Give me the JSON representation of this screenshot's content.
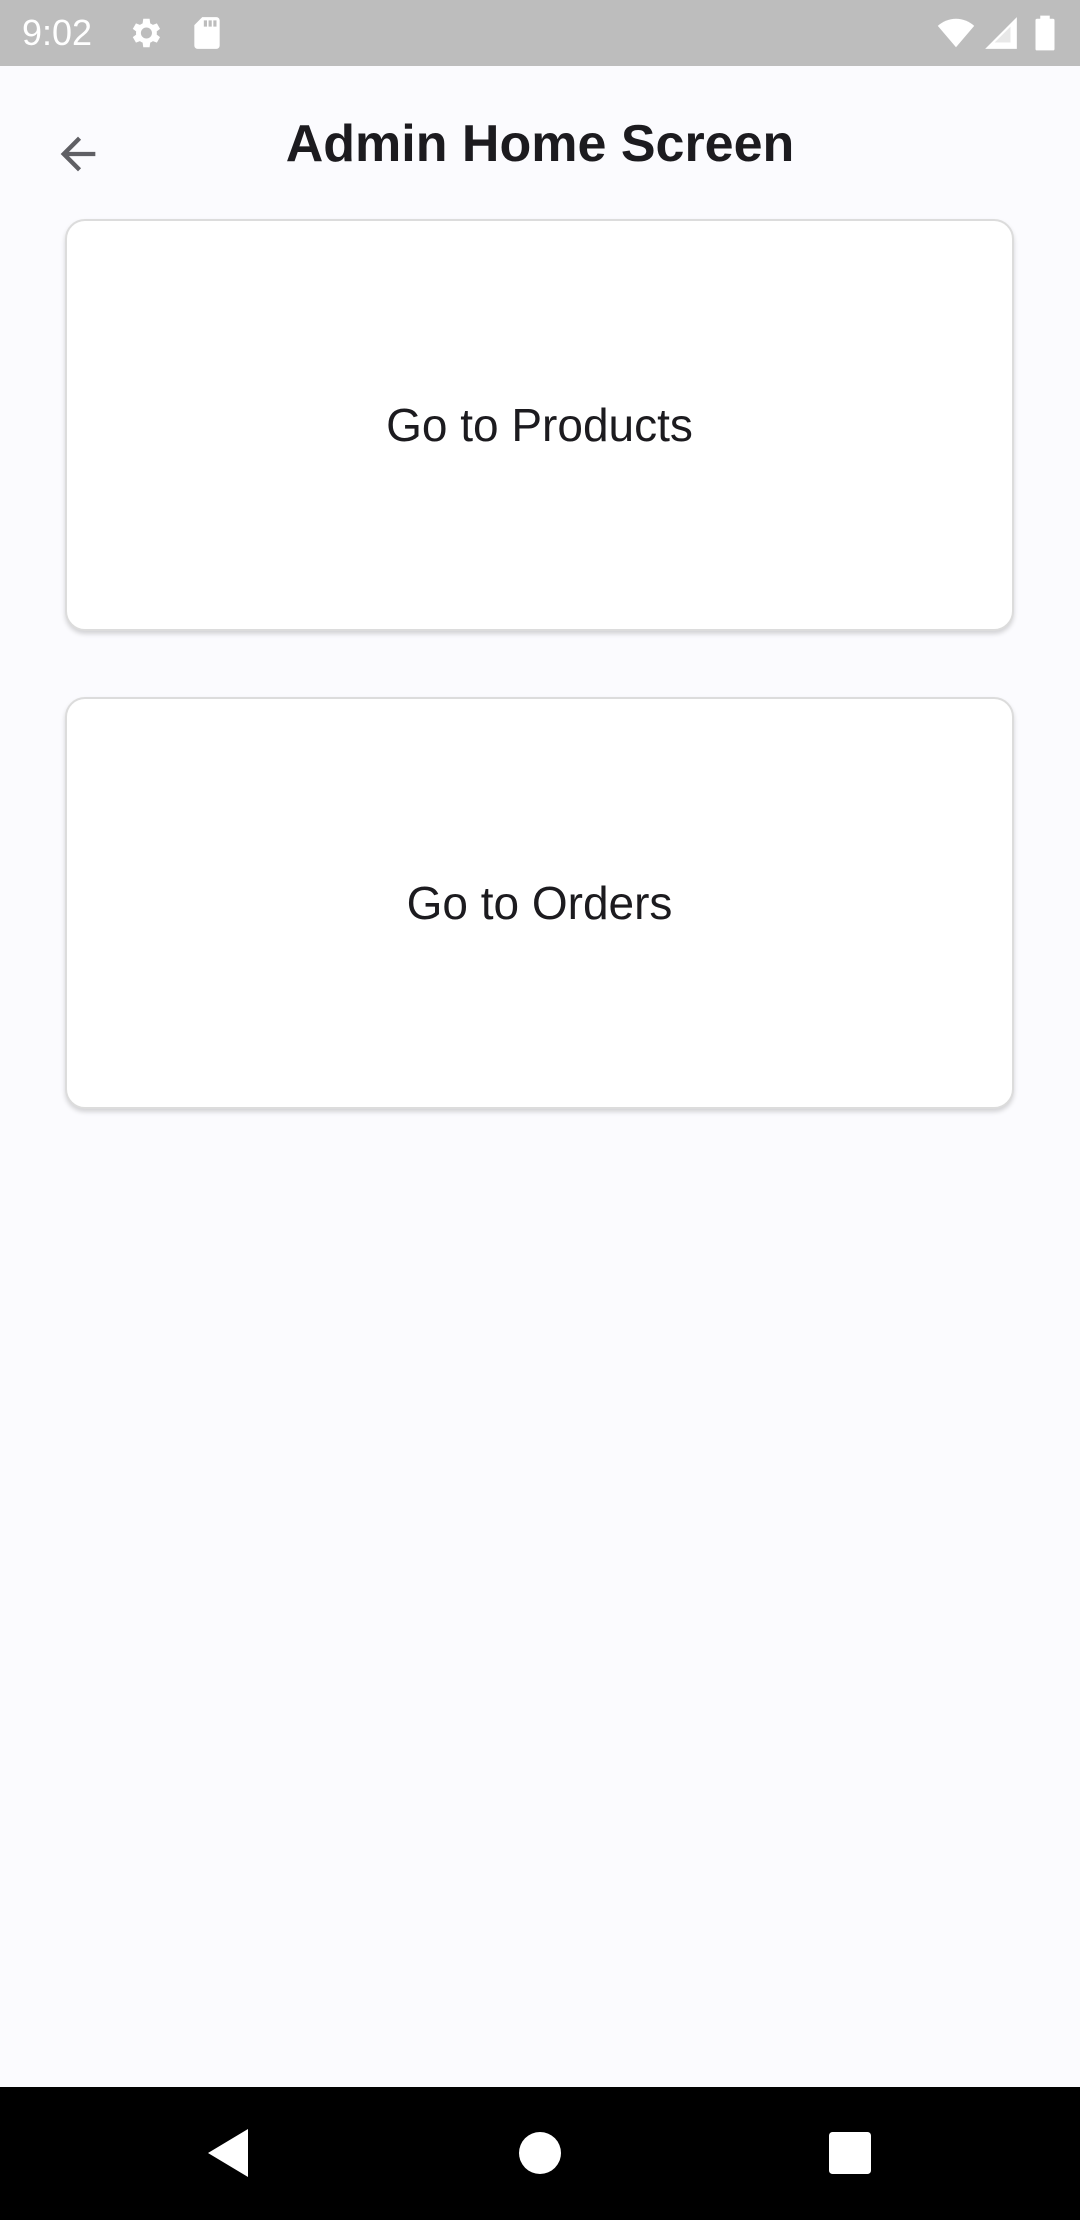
{
  "status_bar": {
    "time": "9:02",
    "icons": [
      "gear-icon",
      "sd-card-icon",
      "wifi-icon",
      "cell-signal-icon",
      "battery-icon"
    ]
  },
  "app_bar": {
    "title": "Admin Home Screen",
    "back_icon": "arrow-back-icon"
  },
  "cards": [
    {
      "label": "Go to Products"
    },
    {
      "label": "Go to Orders"
    }
  ],
  "nav_bar": {
    "icons": [
      "back-triangle-icon",
      "home-circle-icon",
      "recents-square-icon"
    ]
  },
  "colors": {
    "background": "#fbfbfe",
    "status_bar": "#bdbdbd",
    "card": "#ffffff",
    "text": "#1c1b1f",
    "nav_bar": "#000000"
  }
}
